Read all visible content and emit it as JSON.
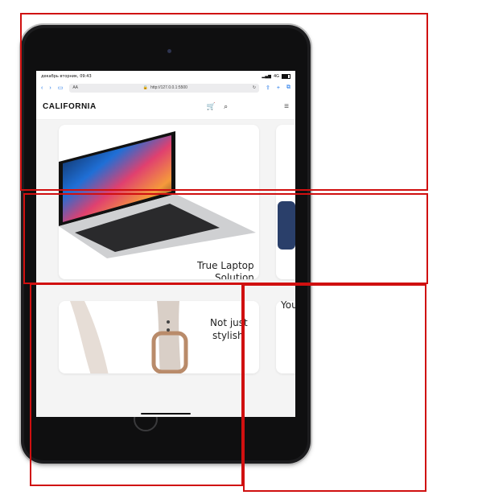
{
  "status_bar": {
    "datetime": "декабрь вторник, 09:43",
    "network": "4G"
  },
  "browser": {
    "text_size": "AA",
    "url": "http://127.0.0.1:5500"
  },
  "site": {
    "logo": "CALIFORNIA"
  },
  "cards": [
    {
      "title_line1": "True Laptop",
      "title_line2": "Solution"
    },
    {
      "title_line1": "Not just",
      "title_line2": "stylish"
    },
    {
      "title_partial": "You"
    }
  ]
}
